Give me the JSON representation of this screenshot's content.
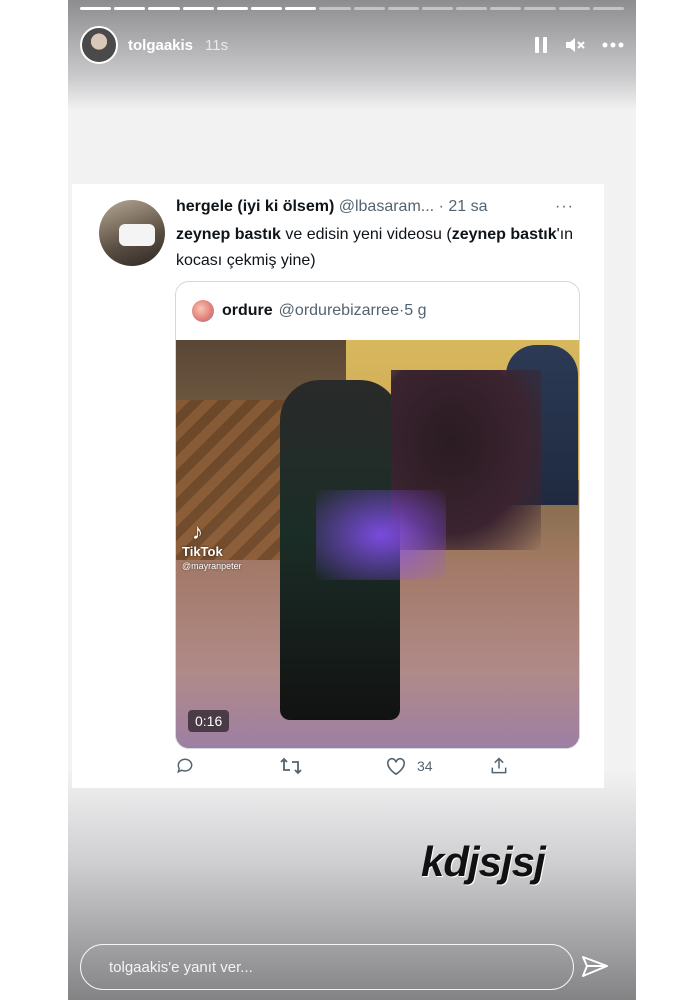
{
  "story": {
    "username": "tolgaakis",
    "time_ago": "11s",
    "progress": {
      "total_segments": 16,
      "completed_segments": 7
    },
    "sticker_text": "kdjsjsj",
    "reply_placeholder": "tolgaakis'e yanıt ver..."
  },
  "tweet": {
    "name": "hergele (iyi ki ölsem)",
    "handle": "@lbasaram...",
    "dot": "·",
    "age": "21 sa",
    "more": "···",
    "text_parts": {
      "bold1": "zeynep bastık",
      "mid": " ve edisin yeni videosu (",
      "bold2": "zeynep bastık",
      "end": "'ın kocası çekmiş yine)"
    },
    "quoted": {
      "name": "ordure",
      "handle": "@ordurebizarree",
      "dot": "·",
      "age": "5 g",
      "video_watermark": "TikTok",
      "video_watermark_handle": "@mayranpeter",
      "video_duration": "0:16"
    },
    "like_count": "34"
  },
  "icons": {
    "pause": "pause-icon",
    "mute": "speaker-muted-icon",
    "more": "more-horizontal-icon",
    "reply": "comment-icon",
    "retweet": "retweet-icon",
    "like": "heart-icon",
    "share": "share-icon",
    "send": "send-icon"
  },
  "colors": {
    "secondary_text": "#536471",
    "card_border": "#cfd9de"
  }
}
